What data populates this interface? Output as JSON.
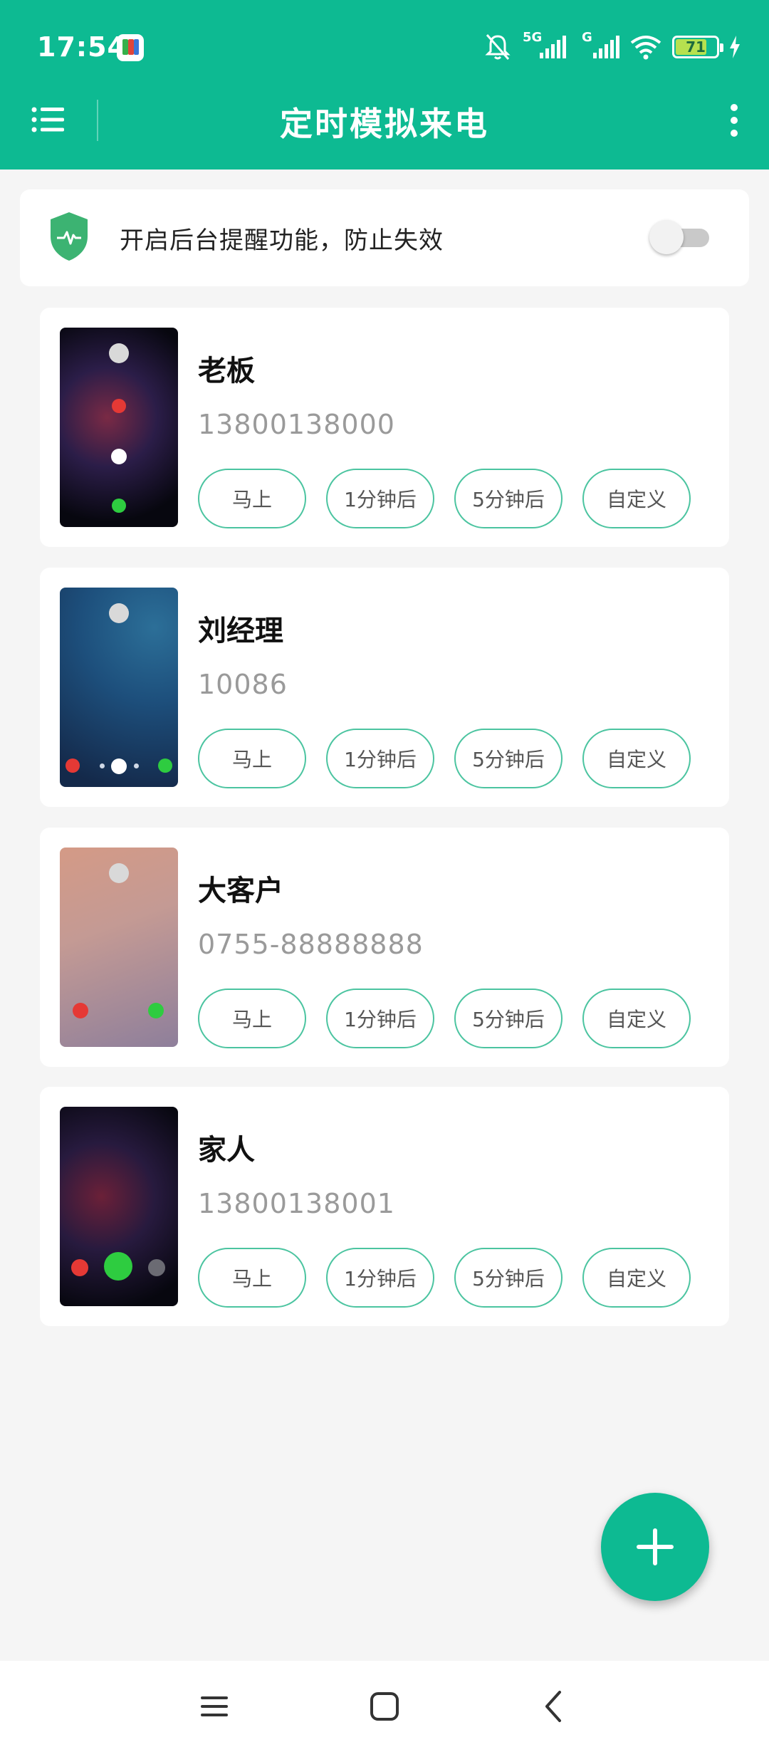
{
  "status": {
    "time": "17:54",
    "net1": "5G",
    "net2": "G",
    "battery": "71"
  },
  "header": {
    "title": "定时模拟来电"
  },
  "banner": {
    "text": "开启后台提醒功能，防止失效",
    "enabled": false
  },
  "button_labels": {
    "now": "马上",
    "one_min": "1分钟后",
    "five_min": "5分钟后",
    "custom": "自定义"
  },
  "contacts": [
    {
      "name": "老板",
      "number": "13800138000"
    },
    {
      "name": "刘经理",
      "number": "10086"
    },
    {
      "name": "大客户",
      "number": "0755-88888888"
    },
    {
      "name": "家人",
      "number": "13800138001"
    }
  ],
  "colors": {
    "primary": "#0dba92",
    "outline": "#4bc4a0",
    "background": "#f5f5f5"
  }
}
